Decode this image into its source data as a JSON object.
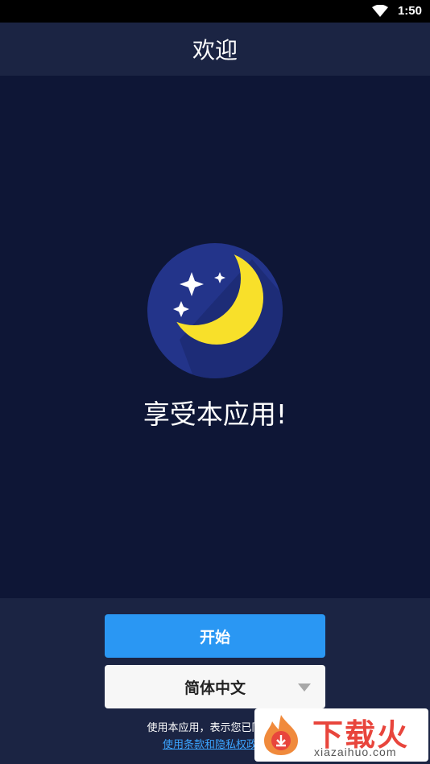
{
  "status": {
    "time": "1:50",
    "wifi_icon": "wifi-icon"
  },
  "header": {
    "title": "欢迎"
  },
  "main": {
    "logo_icon": "moon-stars-icon",
    "tagline": "享受本应用!"
  },
  "actions": {
    "start_label": "开始",
    "language": "简体中文",
    "language_icon": "chevron-down-icon"
  },
  "legal": {
    "notice": "使用本应用，表示您已同意其",
    "terms_link": "使用条款和隐私权政策"
  },
  "watermark": {
    "title": "下载火",
    "url": "xiazaihuo.com"
  },
  "colors": {
    "background": "#0e1636",
    "header": "#1b2443",
    "accent": "#2a97f3",
    "moon": "#f8e02a",
    "link": "#3ba4ff"
  }
}
